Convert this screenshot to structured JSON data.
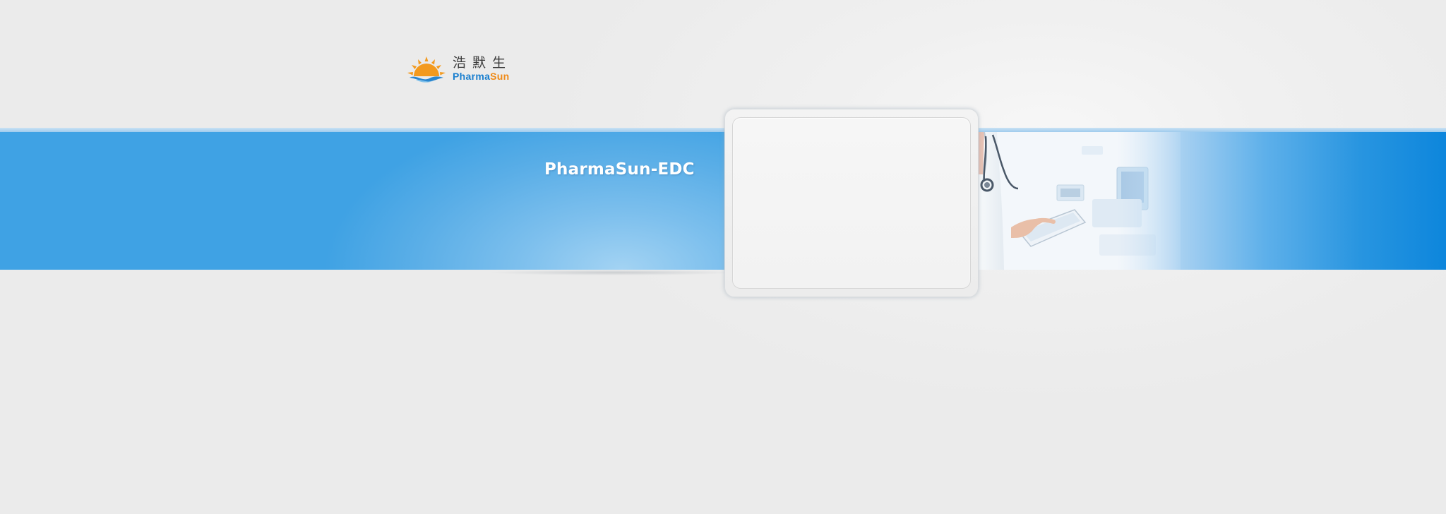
{
  "logo": {
    "chinese_name": "浩默生",
    "english_part1": "Pharma",
    "english_part2": "Sun",
    "mark_icon": "sun-logo-icon",
    "colors": {
      "sun": "#f39a1e",
      "wave": "#2a86cf",
      "text_blue": "#1a7fcf",
      "text_orange": "#ef8a17"
    }
  },
  "banner": {
    "title": "PharmaSun-EDC",
    "image": "doctor-tablet-photo",
    "colors": {
      "band_blue": "#3fa2e4",
      "band_highlight": "#a3d3f3",
      "band_edge": "#0d86dc"
    }
  },
  "login_panel": {
    "state": "empty"
  }
}
